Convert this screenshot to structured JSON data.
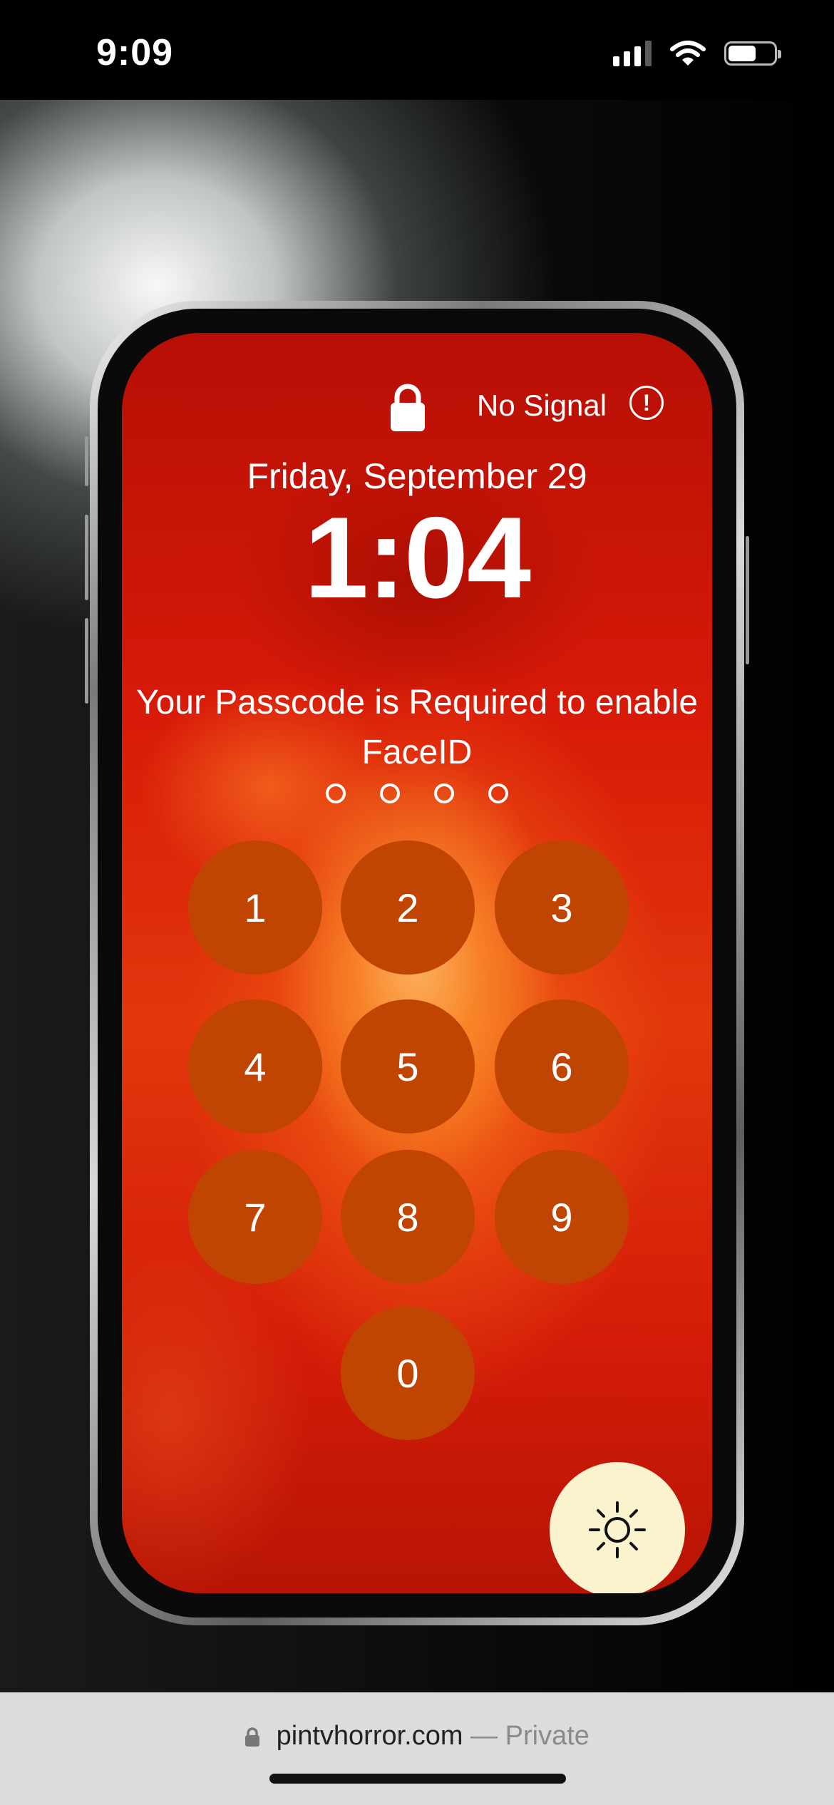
{
  "status_bar": {
    "time": "9:09",
    "signal_bars": 4,
    "signal_bars_active": 3,
    "battery_level": 0.6
  },
  "lockscreen": {
    "status": {
      "no_signal_label": "No Signal",
      "alert_icon_glyph": "!"
    },
    "date": "Friday, September 29",
    "time": "1:04",
    "message": "Your Passcode is Required to enable FaceID",
    "passcode_dots": 4,
    "keypad": [
      "1",
      "2",
      "3",
      "4",
      "5",
      "6",
      "7",
      "8",
      "9",
      "0"
    ],
    "key_color": "#c14502",
    "flashlight_button": {
      "icon": "sun-icon",
      "color": "#fbf3ce"
    }
  },
  "browser": {
    "domain": "pintvhorror.com",
    "separator": "—",
    "mode": "Private"
  }
}
